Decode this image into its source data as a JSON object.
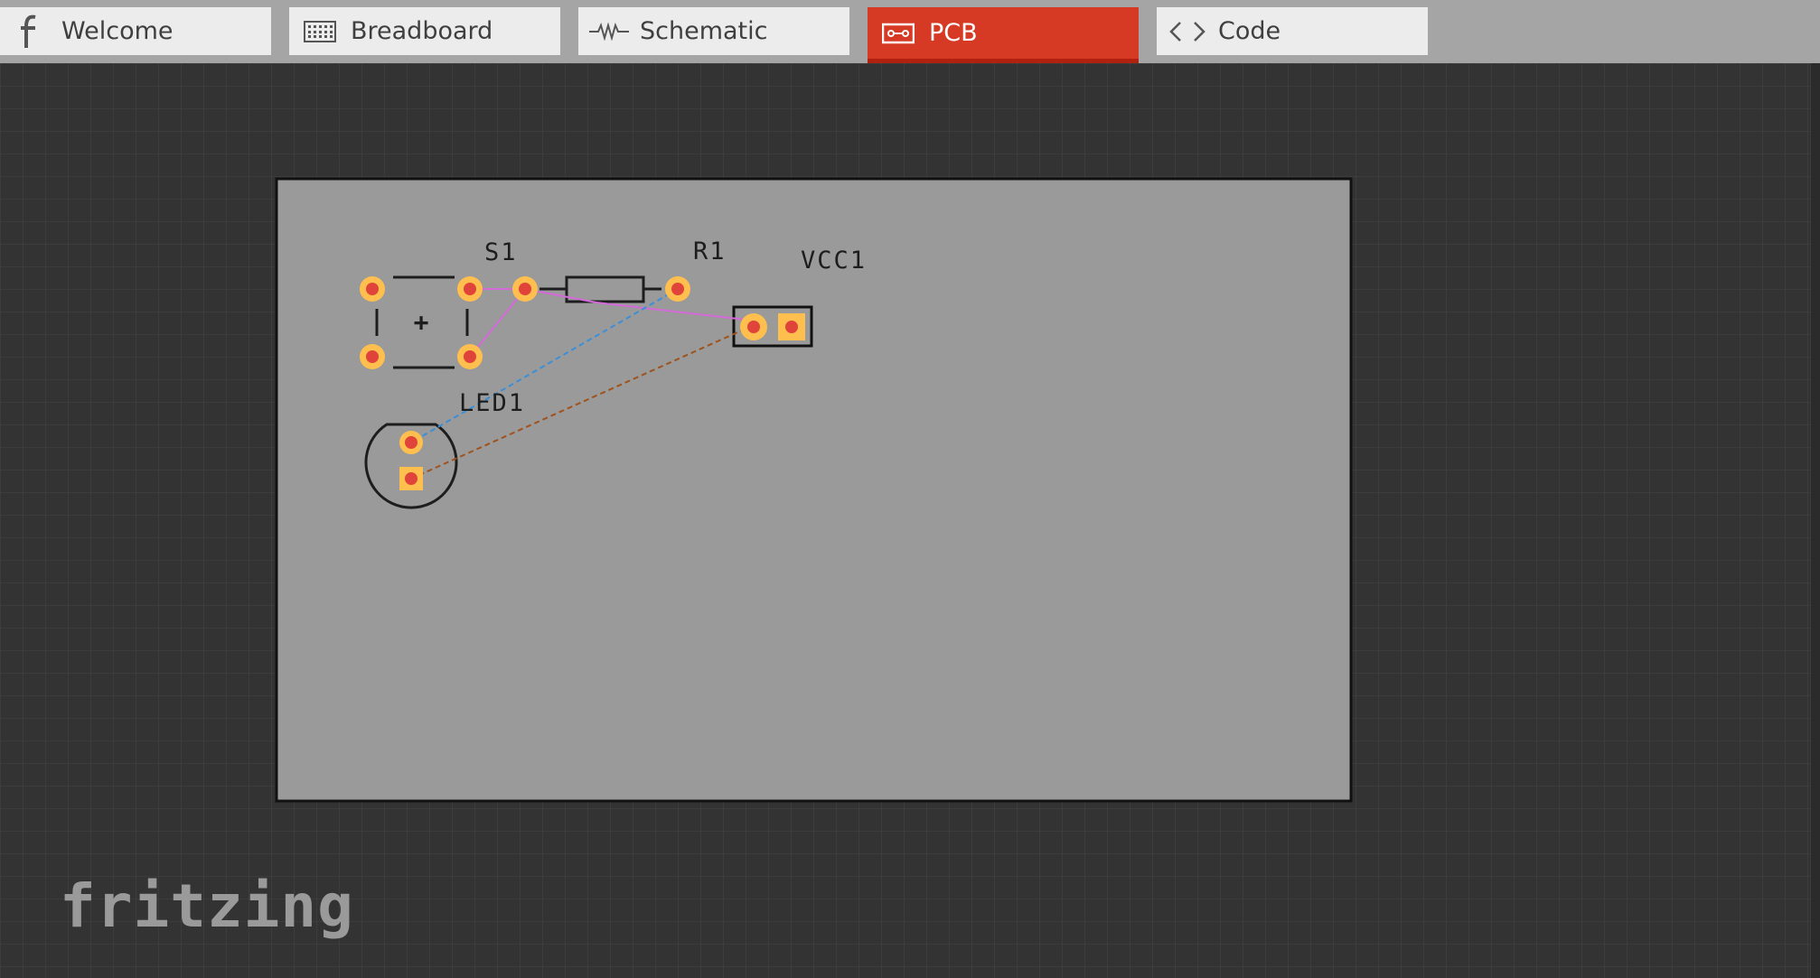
{
  "tabs": [
    {
      "label": "Welcome",
      "icon": "fritzing-f-icon",
      "active": false
    },
    {
      "label": "Breadboard",
      "icon": "breadboard-icon",
      "active": false
    },
    {
      "label": "Schematic",
      "icon": "resistor-wave-icon",
      "active": false
    },
    {
      "label": "PCB",
      "icon": "pcb-icon",
      "active": true
    },
    {
      "label": "Code",
      "icon": "code-brackets-icon",
      "active": false
    }
  ],
  "pcb": {
    "labels": {
      "switch": "S1",
      "resistor": "R1",
      "power": "VCC1",
      "led": "LED1",
      "switch_polarity": "+"
    }
  },
  "logo": "fritzing",
  "colors": {
    "accent": "#d63a24",
    "board": "#9a9a9a",
    "pad_ring": "#ffbf4f",
    "pad_center": "#e0433a",
    "trace_pink": "#d46ad8",
    "ratsnest_blue": "#3a8fd8",
    "ratsnest_brown": "#a0521c"
  }
}
